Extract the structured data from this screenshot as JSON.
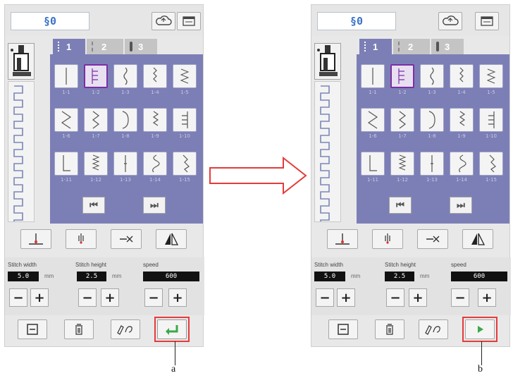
{
  "left_panel": {
    "display_text": "§0",
    "tabs": [
      {
        "label": "1"
      },
      {
        "label": "2"
      },
      {
        "label": "3"
      }
    ],
    "stitch_labels": [
      "1-1",
      "1-2",
      "1-3",
      "1-4",
      "1-5",
      "1-6",
      "1-7",
      "1-8",
      "1-9",
      "1-10",
      "1-11",
      "1-12",
      "1-13",
      "1-14",
      "1-15"
    ],
    "selected_stitch": "1-2",
    "nav_prev": "⏮",
    "nav_next": "⏭",
    "params": [
      {
        "title": "Stitch width",
        "value": "5.0",
        "unit": "mm"
      },
      {
        "title": "Stitch height",
        "value": "2.5",
        "unit": "mm"
      },
      {
        "title": "speed",
        "value": "600",
        "unit": ""
      }
    ],
    "minus": "−",
    "plus": "+",
    "callout_letter": "a"
  },
  "right_panel": {
    "display_text": "§0",
    "tabs": [
      {
        "label": "1"
      },
      {
        "label": "2"
      },
      {
        "label": "3"
      }
    ],
    "stitch_labels": [
      "1-1",
      "1-2",
      "1-3",
      "1-4",
      "1-5",
      "1-6",
      "1-7",
      "1-8",
      "1-9",
      "1-10",
      "1-11",
      "1-12",
      "1-13",
      "1-14",
      "1-15"
    ],
    "selected_stitch": "1-2",
    "nav_prev": "⏮",
    "nav_next": "⏭",
    "params": [
      {
        "title": "Stitch width",
        "value": "5.0",
        "unit": "mm"
      },
      {
        "title": "Stitch height",
        "value": "2.5",
        "unit": "mm"
      },
      {
        "title": "speed",
        "value": "600",
        "unit": ""
      }
    ],
    "minus": "−",
    "plus": "+",
    "callout_letter": "b"
  },
  "colors": {
    "purple": "#7c7fb6",
    "highlight_red": "#e53b3b",
    "enter_green": "#3aa84a",
    "selected_border": "#7a2fa3",
    "display_blue": "#3a72c8"
  },
  "icons": {
    "top_buttons": [
      "cloud-icon",
      "menu-icon"
    ],
    "function_buttons": [
      "needle-up-down-icon",
      "needle-position-icon",
      "thread-cutter-icon",
      "mirror-icon"
    ],
    "bottom_buttons": [
      "save-icon",
      "delete-icon",
      "edit-icon"
    ],
    "left_action": "enter-icon",
    "right_action": "play-icon"
  }
}
